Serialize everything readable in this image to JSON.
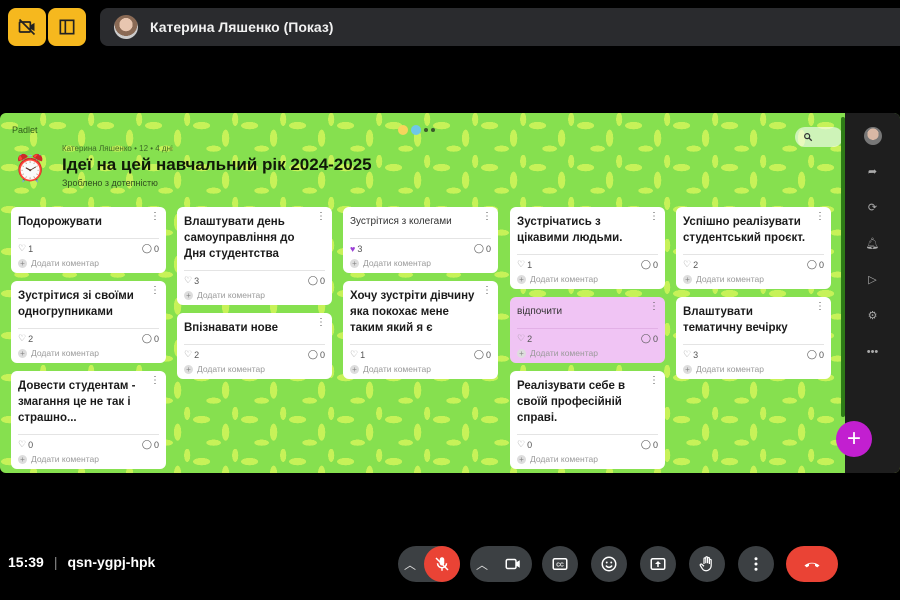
{
  "presenter": {
    "name": "Катерина Ляшенко (Показ)"
  },
  "padlet": {
    "brand": "Padlet",
    "meta": "Катерина Ляшенко • 12 • 4 дні",
    "title": "Ідеї на цей навчальний рік 2024-2025",
    "subtitle": "Зроблено з дотепністю",
    "comment_placeholder": "Додати коментар",
    "columns": [
      [
        {
          "title": "Подорожувати",
          "likes": "1",
          "comments": "0",
          "pink": false,
          "light": false
        },
        {
          "title": "Зустрітися зі своїми одногрупниками",
          "likes": "2",
          "comments": "0",
          "pink": false,
          "light": false
        },
        {
          "title": "Довести студентам - змагання це не так і страшно...",
          "likes": "0",
          "comments": "0",
          "pink": false,
          "light": false
        }
      ],
      [
        {
          "title": "Влаштувати день самоуправління до Дня студентства",
          "likes": "3",
          "comments": "0",
          "pink": false,
          "light": false
        },
        {
          "title": "Впізнавати нове",
          "likes": "2",
          "comments": "0",
          "pink": false,
          "light": false
        }
      ],
      [
        {
          "title": "Зустрітися з колегами",
          "likes": "3",
          "comments": "0",
          "pink": false,
          "light": true
        },
        {
          "title": "Хочу зустріти дівчину яка покохає мене таким який я є",
          "likes": "1",
          "comments": "0",
          "pink": false,
          "light": false
        }
      ],
      [
        {
          "title": "Зустрічатись з цікавими людьми.",
          "likes": "1",
          "comments": "0",
          "pink": false,
          "light": false
        },
        {
          "title": "відпочити",
          "likes": "2",
          "comments": "0",
          "pink": true,
          "light": true
        },
        {
          "title": "Реалізувати себе в своїй професійній справі.",
          "likes": "0",
          "comments": "0",
          "pink": false,
          "light": false
        }
      ],
      [
        {
          "title": "Успішно реалізувати студентський проєкт.",
          "likes": "2",
          "comments": "0",
          "pink": false,
          "light": false
        },
        {
          "title": "Влаштувати тематичну вечірку",
          "likes": "3",
          "comments": "0",
          "pink": false,
          "light": false
        }
      ]
    ]
  },
  "meeting": {
    "time": "15:39",
    "code": "qsn-ygpj-hpk"
  },
  "colors": {
    "accent_yellow": "#f6b81e",
    "mic_off_red": "#ea4335",
    "fab_purple": "#c21fd0",
    "padlet_green": "#86e04f"
  },
  "icons": [
    "no-camera-icon",
    "layout-icon",
    "search-icon",
    "mic-off-icon",
    "camera-icon",
    "captions-icon",
    "emoji-icon",
    "present-icon",
    "raise-hand-icon",
    "more-icon",
    "end-call-icon"
  ]
}
